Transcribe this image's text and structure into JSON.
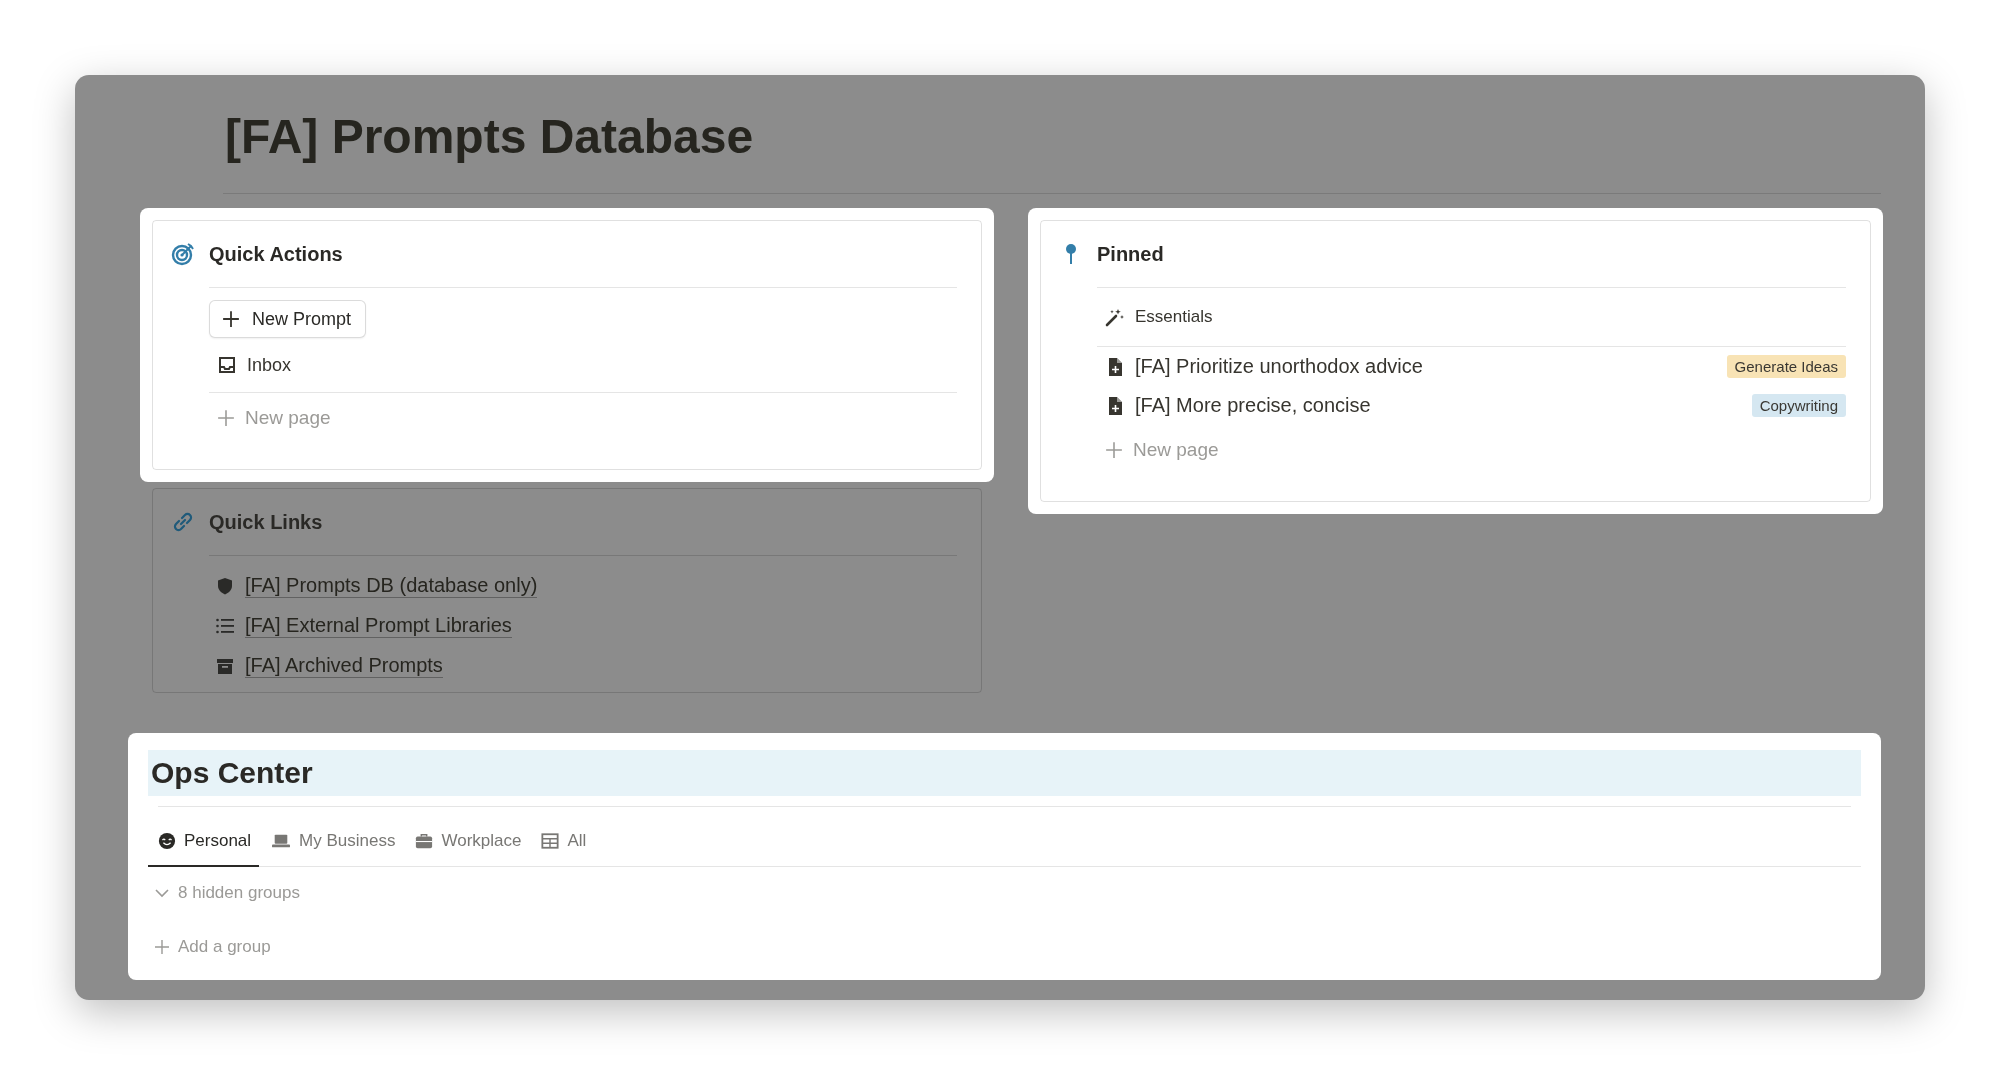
{
  "title": "[FA] Prompts Database",
  "quick_actions": {
    "title": "Quick Actions",
    "highlighted": true,
    "button": "New Prompt",
    "items": [
      {
        "label": "Inbox"
      }
    ],
    "new_page": "New page"
  },
  "quick_links": {
    "title": "Quick Links",
    "highlighted": false,
    "links": [
      {
        "label": "[FA] Prompts DB (database only)",
        "kind": "shield"
      },
      {
        "label": "[FA] External Prompt Libraries",
        "kind": "list"
      },
      {
        "label": "[FA] Archived Prompts",
        "kind": "archive"
      }
    ]
  },
  "pinned": {
    "title": "Pinned",
    "highlighted": true,
    "group": "Essentials",
    "items": [
      {
        "label": "[FA] Prioritize unorthodox advice",
        "tag": "Generate Ideas",
        "color": "#f8e3b5"
      },
      {
        "label": "[FA] More precise, concise",
        "tag": "Copywriting",
        "color": "#d5e7f1"
      }
    ],
    "new_page": "New page"
  },
  "ops_center": {
    "title": "Ops Center",
    "highlighted": true,
    "tabs": [
      {
        "label": "Personal",
        "kind": "face",
        "selected": true
      },
      {
        "label": "My Business",
        "kind": "laptop",
        "selected": false
      },
      {
        "label": "Workplace",
        "kind": "briefcase",
        "selected": false
      },
      {
        "label": "All",
        "kind": "table",
        "selected": false
      }
    ],
    "hidden_groups": "8 hidden groups",
    "add_group": "Add a group"
  }
}
